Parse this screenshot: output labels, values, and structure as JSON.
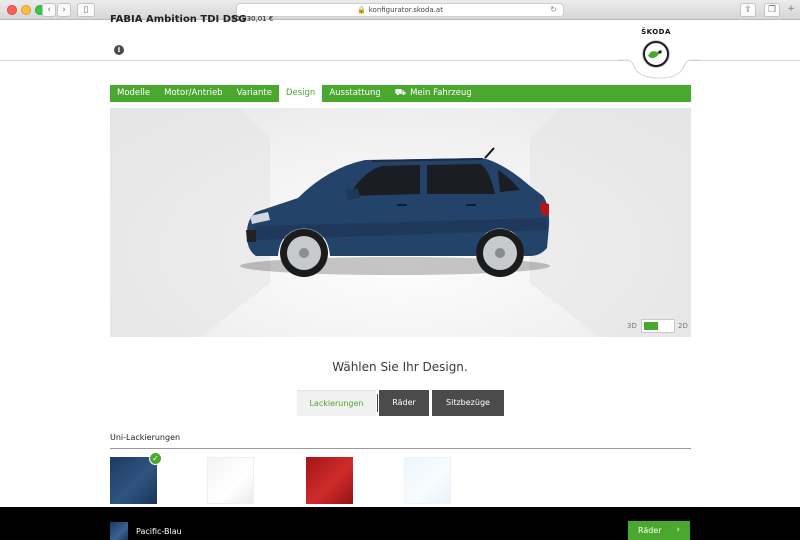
{
  "browser": {
    "url": "konfigurator.skoda.at",
    "back_icon": "chevron-left-icon",
    "forward_icon": "chevron-right-icon",
    "sidebar_icon": "sidebar-icon",
    "share_icon": "share-icon",
    "tabs_icon": "tabs-icon"
  },
  "header": {
    "model": "FABIA Ambition TDI DSG",
    "price": "20.030,01 €",
    "info": "i",
    "brand": "ŠKODA"
  },
  "nav": {
    "items": [
      {
        "label": "Modelle"
      },
      {
        "label": "Motor/Antrieb"
      },
      {
        "label": "Variante"
      },
      {
        "label": "Design",
        "active": true
      },
      {
        "label": "Ausstattung"
      },
      {
        "label": "Mein Fahrzeug",
        "icon": "car-icon"
      }
    ]
  },
  "viewer": {
    "label_3d": "3D",
    "label_2d": "2D",
    "car_color": "#24436a"
  },
  "design": {
    "heading": "Wählen Sie Ihr Design.",
    "tabs": [
      "Lackierungen",
      "Räder",
      "Sitzbezüge"
    ]
  },
  "colors": {
    "section_label": "Uni-Lackierungen",
    "swatches": [
      {
        "hex": "#24436a",
        "selected": true
      },
      {
        "hex": "#f6f6f6"
      },
      {
        "hex": "#b91c1f"
      },
      {
        "hex": "#f1f8fd"
      }
    ]
  },
  "footer": {
    "selected_color": "Pacific-Blau",
    "next_label": "Räder",
    "next_chevron": "›"
  },
  "theme": {
    "accent": "#4ba82e",
    "dark_tab": "#4b4b4b"
  }
}
